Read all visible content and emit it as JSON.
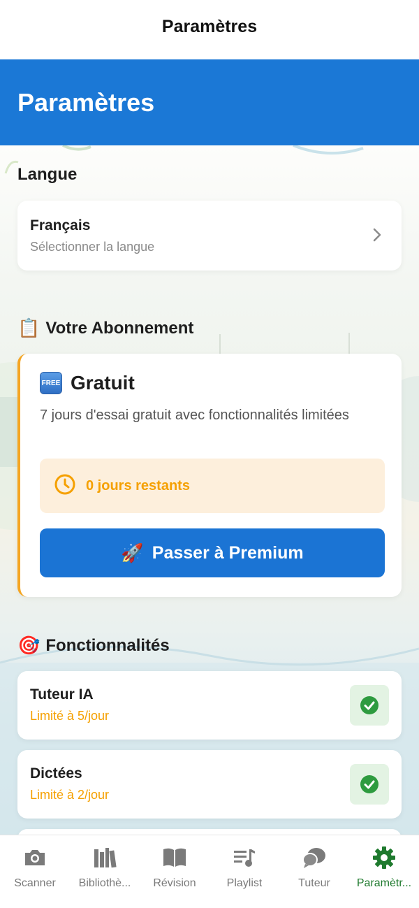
{
  "nav": {
    "title": "Paramètres"
  },
  "header": {
    "title": "Paramètres"
  },
  "language": {
    "section_title": "Langue",
    "value": "Français",
    "subtitle": "Sélectionner la langue",
    "chevron_icon": "chevron-right-icon"
  },
  "subscription": {
    "section_emoji": "📋",
    "section_title": "Votre Abonnement",
    "plan_badge": "FREE",
    "plan_name": "Gratuit",
    "description": "7 jours d'essai gratuit avec fonctionnalités limitées",
    "days_remaining_text": "0 jours restants",
    "upgrade_emoji": "🚀",
    "upgrade_label": "Passer à Premium",
    "accent_color": "#f5a623",
    "button_color": "#1b74d4"
  },
  "features": {
    "section_emoji": "🎯",
    "section_title": "Fonctionnalités",
    "items": [
      {
        "name": "Tuteur IA",
        "limit": "Limité à 5/jour",
        "status": "check-circle-icon"
      },
      {
        "name": "Dictées",
        "limit": "Limité à 2/jour",
        "status": "check-circle-icon"
      }
    ]
  },
  "tabs": [
    {
      "label": "Scanner",
      "icon": "camera-icon",
      "active": false
    },
    {
      "label": "Bibliothè...",
      "icon": "library-icon",
      "active": false
    },
    {
      "label": "Révision",
      "icon": "book-open-icon",
      "active": false
    },
    {
      "label": "Playlist",
      "icon": "playlist-icon",
      "active": false
    },
    {
      "label": "Tuteur",
      "icon": "chat-bubbles-icon",
      "active": false
    },
    {
      "label": "Paramètr...",
      "icon": "gear-icon",
      "active": true
    }
  ],
  "colors": {
    "header": "#1b78d6",
    "active_tab": "#1f7a2e",
    "inactive_tab": "#7a7a7a",
    "warning": "#f5a000"
  }
}
